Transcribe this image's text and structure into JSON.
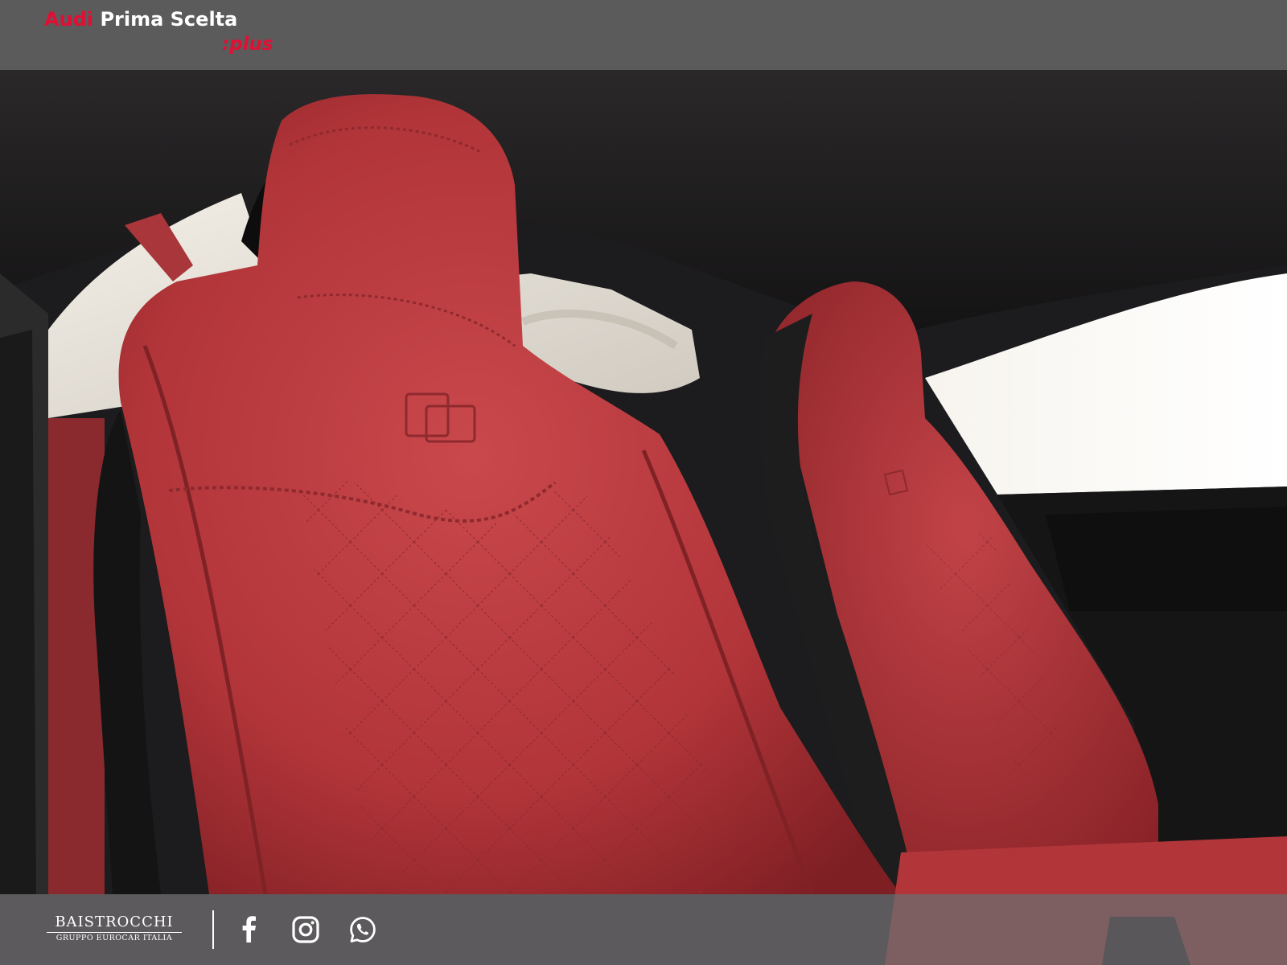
{
  "header": {
    "brand_audi": "Audi",
    "brand_rest": "Prima Scelta",
    "brand_plus": ":plus"
  },
  "footer": {
    "dealer_name": "BAISTROCCHI",
    "dealer_tagline": "GRUPPO EUROCAR ITALIA",
    "social_icons": [
      "facebook-icon",
      "instagram-icon",
      "whatsapp-icon"
    ]
  },
  "colors": {
    "brand_red": "#e30e34",
    "header_bg": "#5b5b5c",
    "footer_bg": "#6e6c6e",
    "leather_red": "#b8383f"
  }
}
